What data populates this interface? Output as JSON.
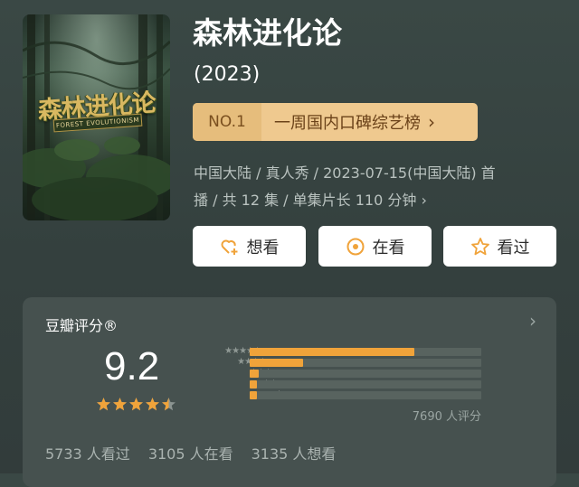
{
  "show": {
    "title": "森林进化论",
    "year": "(2023)",
    "poster_title": "森林进化论",
    "poster_subtitle": "FOREST EVOLUTIONISM"
  },
  "ranking": {
    "badge": "NO.1",
    "label": "一周国内口碑综艺榜",
    "chevron": "›",
    "color_bg": "#efc98f",
    "color_text": "#6b4219"
  },
  "meta": {
    "line1": "中国大陆 / 真人秀 / 2023-07-15(中国大陆) 首",
    "line2": "播 / 共 12 集 / 单集片长 110 分钟",
    "chevron": "›"
  },
  "actions": [
    {
      "label": "想看",
      "icon": "heart-plus-icon"
    },
    {
      "label": "在看",
      "icon": "target-icon"
    },
    {
      "label": "看过",
      "icon": "star-outline-icon"
    }
  ],
  "rating": {
    "source_label": "豆瓣评分®",
    "chevron": "›",
    "score": "9.2",
    "stars_filled": 4.5,
    "rating_count": "7690 人评分",
    "distribution": [
      {
        "stars": 5,
        "fraction": 0.71
      },
      {
        "stars": 4,
        "fraction": 0.23
      },
      {
        "stars": 3,
        "fraction": 0.04
      },
      {
        "stars": 2,
        "fraction": 0.01
      },
      {
        "stars": 1,
        "fraction": 0.01
      }
    ],
    "accent_color": "#f0a33a"
  },
  "stats": {
    "watched": "5733 人看过",
    "watching": "3105 人在看",
    "want": "3135 人想看"
  }
}
